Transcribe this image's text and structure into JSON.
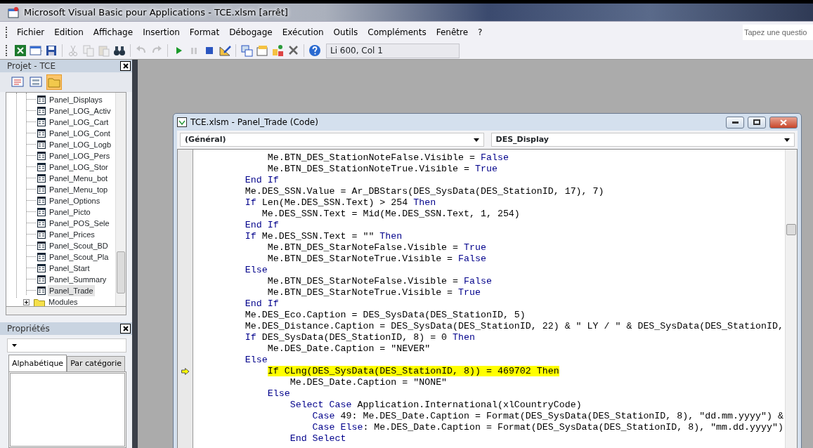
{
  "window": {
    "title": "Microsoft Visual Basic pour Applications - TCE.xlsm [arrêt]"
  },
  "menu": [
    "Fichier",
    "Edition",
    "Affichage",
    "Insertion",
    "Format",
    "Débogage",
    "Exécution",
    "Outils",
    "Compléments",
    "Fenêtre",
    "?"
  ],
  "help_box": {
    "placeholder": "Tapez une questio"
  },
  "toolbar": [
    {
      "kind": "excel",
      "disabled": false
    },
    {
      "kind": "insert",
      "disabled": false
    },
    {
      "kind": "save",
      "disabled": false
    },
    {
      "kind": "cut",
      "disabled": true
    },
    {
      "kind": "copy",
      "disabled": true
    },
    {
      "kind": "paste",
      "disabled": true
    },
    {
      "kind": "find",
      "disabled": false
    },
    {
      "kind": "undo",
      "disabled": true
    },
    {
      "kind": "redo",
      "disabled": true
    },
    {
      "kind": "run",
      "disabled": false
    },
    {
      "kind": "pause",
      "disabled": true
    },
    {
      "kind": "stop",
      "disabled": false
    },
    {
      "kind": "design",
      "disabled": false
    },
    {
      "kind": "project",
      "disabled": false
    },
    {
      "kind": "properties",
      "disabled": false
    },
    {
      "kind": "objects",
      "disabled": false
    },
    {
      "kind": "tools",
      "disabled": false
    },
    {
      "kind": "help",
      "disabled": false
    }
  ],
  "position": "Li 600, Col 1",
  "project": {
    "title": "Projet - TCE",
    "view_buttons": [
      {
        "kind": "code",
        "on": false
      },
      {
        "kind": "object",
        "on": false
      },
      {
        "kind": "folders",
        "on": true
      }
    ],
    "forms": [
      {
        "label": "Panel_Displays",
        "selected": false
      },
      {
        "label": "Panel_LOG_Activ",
        "selected": false
      },
      {
        "label": "Panel_LOG_Cart",
        "selected": false
      },
      {
        "label": "Panel_LOG_Cont",
        "selected": false
      },
      {
        "label": "Panel_LOG_Logb",
        "selected": false
      },
      {
        "label": "Panel_LOG_Pers",
        "selected": false
      },
      {
        "label": "Panel_LOG_Stor",
        "selected": false
      },
      {
        "label": "Panel_Menu_bot",
        "selected": false
      },
      {
        "label": "Panel_Menu_top",
        "selected": false
      },
      {
        "label": "Panel_Options",
        "selected": false
      },
      {
        "label": "Panel_Picto",
        "selected": false
      },
      {
        "label": "Panel_POS_Sele",
        "selected": false
      },
      {
        "label": "Panel_Prices",
        "selected": false
      },
      {
        "label": "Panel_Scout_BD",
        "selected": false
      },
      {
        "label": "Panel_Scout_Pla",
        "selected": false
      },
      {
        "label": "Panel_Start",
        "selected": false
      },
      {
        "label": "Panel_Summary",
        "selected": false
      },
      {
        "label": "Panel_Trade",
        "selected": true
      }
    ],
    "folders": [
      {
        "label": "Modules",
        "expanded": false
      }
    ]
  },
  "properties": {
    "title": "Propriétés",
    "tabs": [
      {
        "label": "Alphabétique",
        "selected": true
      },
      {
        "label": "Par catégorie",
        "selected": false
      }
    ]
  },
  "code_window": {
    "title": "TCE.xlsm - Panel_Trade (Code)",
    "object_combo": "(Général)",
    "procedure_combo": "DES_Display",
    "lines": [
      {
        "current": false,
        "segments": [
          {
            "text": "            Me.BTN_DES_StationNoteFalse.Visible = ",
            "kind": "plain"
          },
          {
            "text": "False",
            "kind": "keyword"
          }
        ]
      },
      {
        "current": false,
        "segments": [
          {
            "text": "            Me.BTN_DES_StationNoteTrue.Visible = ",
            "kind": "plain"
          },
          {
            "text": "True",
            "kind": "keyword"
          }
        ]
      },
      {
        "current": false,
        "segments": [
          {
            "text": "        End If",
            "kind": "keyword"
          }
        ]
      },
      {
        "current": false,
        "segments": [
          {
            "text": "        Me.DES_SSN.Value = Ar_DBStars(DES_SysData(DES_StationID, 17), 7)",
            "kind": "plain"
          }
        ]
      },
      {
        "current": false,
        "segments": [
          {
            "text": "        If",
            "kind": "keyword"
          },
          {
            "text": " Len(Me.DES_SSN.Text) > 254 ",
            "kind": "plain"
          },
          {
            "text": "Then",
            "kind": "keyword"
          }
        ]
      },
      {
        "current": false,
        "segments": [
          {
            "text": "           Me.DES_SSN.Text = Mid(Me.DES_SSN.Text, 1, 254)",
            "kind": "plain"
          }
        ]
      },
      {
        "current": false,
        "segments": [
          {
            "text": "        End If",
            "kind": "keyword"
          }
        ]
      },
      {
        "current": false,
        "segments": [
          {
            "text": "        If",
            "kind": "keyword"
          },
          {
            "text": " Me.DES_SSN.Text = \"\" ",
            "kind": "plain"
          },
          {
            "text": "Then",
            "kind": "keyword"
          }
        ]
      },
      {
        "current": false,
        "segments": [
          {
            "text": "            Me.BTN_DES_StarNoteFalse.Visible = ",
            "kind": "plain"
          },
          {
            "text": "True",
            "kind": "keyword"
          }
        ]
      },
      {
        "current": false,
        "segments": [
          {
            "text": "            Me.BTN_DES_StarNoteTrue.Visible = ",
            "kind": "plain"
          },
          {
            "text": "False",
            "kind": "keyword"
          }
        ]
      },
      {
        "current": false,
        "segments": [
          {
            "text": "        Else",
            "kind": "keyword"
          }
        ]
      },
      {
        "current": false,
        "segments": [
          {
            "text": "            Me.BTN_DES_StarNoteFalse.Visible = ",
            "kind": "plain"
          },
          {
            "text": "False",
            "kind": "keyword"
          }
        ]
      },
      {
        "current": false,
        "segments": [
          {
            "text": "            Me.BTN_DES_StarNoteTrue.Visible = ",
            "kind": "plain"
          },
          {
            "text": "True",
            "kind": "keyword"
          }
        ]
      },
      {
        "current": false,
        "segments": [
          {
            "text": "        End If",
            "kind": "keyword"
          }
        ]
      },
      {
        "current": false,
        "segments": [
          {
            "text": "        Me.DES_Eco.Caption = DES_SysData(DES_StationID, 5)",
            "kind": "plain"
          }
        ]
      },
      {
        "current": false,
        "segments": [
          {
            "text": "        Me.DES_Distance.Caption = DES_SysData(DES_StationID, 22) & \" LY / \" & DES_SysData(DES_StationID,",
            "kind": "plain"
          }
        ]
      },
      {
        "current": false,
        "segments": [
          {
            "text": "        If",
            "kind": "keyword"
          },
          {
            "text": " DES_SysData(DES_StationID, 8) = 0 ",
            "kind": "plain"
          },
          {
            "text": "Then",
            "kind": "keyword"
          }
        ]
      },
      {
        "current": false,
        "segments": [
          {
            "text": "            Me.DES_Date.Caption = \"NEVER\"",
            "kind": "plain"
          }
        ]
      },
      {
        "current": false,
        "segments": [
          {
            "text": "        Else",
            "kind": "keyword"
          }
        ]
      },
      {
        "current": true,
        "segments": [
          {
            "text": "            If CLng(DES_SysData(DES_StationID, 8)) = 469702 Then",
            "kind": "plain"
          }
        ]
      },
      {
        "current": false,
        "segments": [
          {
            "text": "                Me.DES_Date.Caption = \"NONE\"",
            "kind": "plain"
          }
        ]
      },
      {
        "current": false,
        "segments": [
          {
            "text": "            Else",
            "kind": "keyword"
          }
        ]
      },
      {
        "current": false,
        "segments": [
          {
            "text": "                Select Case",
            "kind": "keyword"
          },
          {
            "text": " Application.International(xlCountryCode)",
            "kind": "plain"
          }
        ]
      },
      {
        "current": false,
        "segments": [
          {
            "text": "                    Case",
            "kind": "keyword"
          },
          {
            "text": " 49: Me.DES_Date.Caption = Format(DES_SysData(DES_StationID, 8), \"dd.mm.yyyy\") &",
            "kind": "plain"
          }
        ]
      },
      {
        "current": false,
        "segments": [
          {
            "text": "                    Case Else",
            "kind": "keyword"
          },
          {
            "text": ": Me.DES_Date.Caption = Format(DES_SysData(DES_StationID, 8), \"mm.dd.yyyy\")",
            "kind": "plain"
          }
        ]
      },
      {
        "current": false,
        "segments": [
          {
            "text": "                End Select",
            "kind": "keyword"
          }
        ]
      }
    ]
  }
}
